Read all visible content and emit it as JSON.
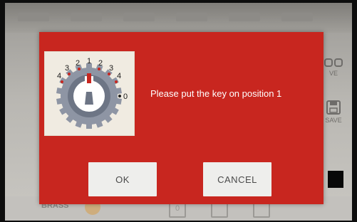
{
  "background_app": {
    "side_labels": [
      "VE",
      "SAVE"
    ],
    "bottom_label": "BRASS",
    "bottom_icon_text": "0"
  },
  "dialog": {
    "message": "Please put the key on position 1",
    "ok_label": "OK",
    "cancel_label": "CANCEL",
    "accent_color": "#c8261f",
    "dial": {
      "left_numbers": [
        "4",
        "3",
        "2"
      ],
      "center_number": "1",
      "right_numbers": [
        "2",
        "3",
        "4"
      ],
      "zero_label": "0",
      "selected_position": "1",
      "icon": "key-position-dial-icon"
    }
  }
}
